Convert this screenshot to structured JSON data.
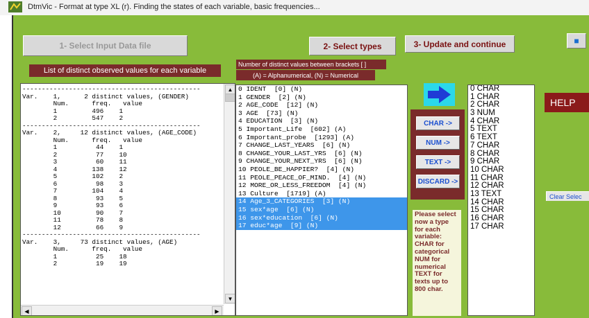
{
  "window": {
    "title": "DtmVic - Format at type XL (r). Finding the states of each variable, basic frequencies..."
  },
  "toolbar": {
    "step1_label": "1- Select Input Data file",
    "step2_label": "2- Select types",
    "step3_label": "3- Update and continue"
  },
  "left_panel": {
    "header": "List of distinct observed values for each variable",
    "lines": [
      "----------------------------------------------",
      "Var.    1,      2 distinct values, (GENDER)",
      "        Num.      freq.   value",
      "        1         496    1",
      "        2         547    2",
      "----------------------------------------------",
      "Var.    2,     12 distinct values, (AGE_CODE)",
      "        Num.      freq.   value",
      "        1          44    1",
      "        2          77    10",
      "        3          60    11",
      "        4         138    12",
      "        5         102    2",
      "        6          98    3",
      "        7         104    4",
      "        8          93    5",
      "        9          93    6",
      "        10         90    7",
      "        11         78    8",
      "        12         66    9",
      "----------------------------------------------",
      "Var.    3,     73 distinct values, (AGE)",
      "        Num.      freq.   value",
      "        1          25    18",
      "        2          19    19"
    ]
  },
  "middle_panel": {
    "header_line1": "Number of distinct values between brackets [ ]",
    "header_line2": "(A) = Alphanumerical,  (N) = Numerical",
    "items": [
      {
        "text": "0 IDENT  [0] (N)",
        "selected": false
      },
      {
        "text": "1 GENDER  [2] (N)",
        "selected": false
      },
      {
        "text": "2 AGE_CODE  [12] (N)",
        "selected": false
      },
      {
        "text": "3 AGE  [73] (N)",
        "selected": false
      },
      {
        "text": "4 EDUCATION  [3] (N)",
        "selected": false
      },
      {
        "text": "5 Important_Life  [602] (A)",
        "selected": false
      },
      {
        "text": "6 Important_probe  [1293] (A)",
        "selected": false
      },
      {
        "text": "7 CHANGE_LAST_YEARS  [6] (N)",
        "selected": false
      },
      {
        "text": "8 CHANGE_YOUR_LAST_YRS  [6] (N)",
        "selected": false
      },
      {
        "text": "9 CHANGE_YOUR_NEXT_YRS  [6] (N)",
        "selected": false
      },
      {
        "text": "10 PEOLE_BE_HAPPIER?  [4] (N)",
        "selected": false
      },
      {
        "text": "11 PEOLE_PEACE_OF_MIND.  [4] (N)",
        "selected": false
      },
      {
        "text": "12 MORE_OR_LESS_FREEDOM  [4] (N)",
        "selected": false
      },
      {
        "text": "13 Culture  [1719] (A)",
        "selected": false
      },
      {
        "text": "14 Age_3_CATEGORIES  [3] (N)",
        "selected": true
      },
      {
        "text": "15 sex*age  [6] (N)",
        "selected": true
      },
      {
        "text": "16 sex*education  [6] (N)",
        "selected": true
      },
      {
        "text": "17 educ*age  [9] (N)",
        "selected": true
      }
    ]
  },
  "type_buttons": {
    "char": "CHAR ->",
    "num": "NUM ->",
    "text": "TEXT ->",
    "discard": "DISCARD ->"
  },
  "instructions": "Please select now a type for each variable: CHAR for categorical NUM for numerical TEXT for texts up to 800 char.",
  "type_list": [
    "0 CHAR",
    "1 CHAR",
    "2 CHAR",
    "3 NUM",
    "4 CHAR",
    "5 TEXT",
    "6 TEXT",
    "7 CHAR",
    "8 CHAR",
    "9 CHAR",
    "10 CHAR",
    "11 CHAR",
    "12 CHAR",
    "13 TEXT",
    "14 CHAR",
    "15 CHAR",
    "16 CHAR",
    "17 CHAR"
  ],
  "help_label": "HELP",
  "clear_label": "Clear Selec",
  "colors": {
    "background": "#88bb3a",
    "header_bg": "#7a2b2b",
    "selection": "#3e96ea",
    "arrow_box": "#2bd8ea",
    "help_bg": "#8b1a1a"
  }
}
